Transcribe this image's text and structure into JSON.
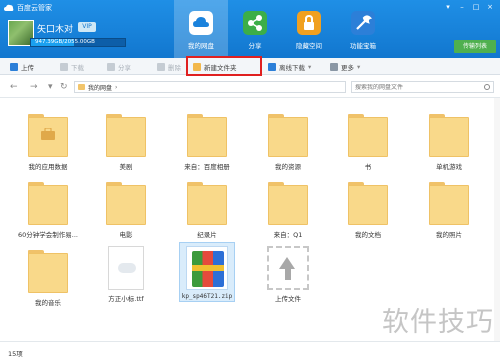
{
  "app": {
    "title": "百度云管家"
  },
  "user": {
    "name": "矢口木对",
    "vip_label": "VIP",
    "quota_text": "947.39GB/2055.00GB",
    "quota_fraction": 0.46
  },
  "nav_tabs": [
    {
      "label": "我的网盘",
      "icon": "cloud-drive-icon",
      "color": "#ffffff"
    },
    {
      "label": "分享",
      "icon": "share-icon",
      "color": "#3cae48"
    },
    {
      "label": "隐藏空间",
      "icon": "lock-icon",
      "color": "#f0a020"
    },
    {
      "label": "功能宝箱",
      "icon": "tools-icon",
      "color": "#2c7fd8"
    }
  ],
  "transfer_button": "传输列表",
  "toolbar": {
    "upload": "上传",
    "download": "下载",
    "share": "分享",
    "delete": "删除",
    "new_folder": "新建文件夹",
    "offline_download": "离线下载",
    "more": "更多"
  },
  "address": {
    "path": "我的网盘",
    "search_placeholder": "搜索我的网盘文件"
  },
  "files": [
    {
      "name": "我的应用数据",
      "type": "folder-app"
    },
    {
      "name": "美剧",
      "type": "folder"
    },
    {
      "name": "来自：百度相册",
      "type": "folder"
    },
    {
      "name": "我的资源",
      "type": "folder"
    },
    {
      "name": "书",
      "type": "folder"
    },
    {
      "name": "单机游戏",
      "type": "folder"
    },
    {
      "name": "60分钟学会制作易...",
      "type": "folder"
    },
    {
      "name": "电影",
      "type": "folder"
    },
    {
      "name": "纪录片",
      "type": "folder"
    },
    {
      "name": "来自：Q1",
      "type": "folder"
    },
    {
      "name": "我的文档",
      "type": "folder"
    },
    {
      "name": "我的照片",
      "type": "folder"
    },
    {
      "name": "我的音乐",
      "type": "folder"
    },
    {
      "name": "方正小标.ttf",
      "type": "doc"
    },
    {
      "name": "kp_sp46T21.zip",
      "type": "zip"
    },
    {
      "name": "上传文件",
      "type": "upload"
    }
  ],
  "status": {
    "count": "15项"
  },
  "watermark": "软件技巧",
  "colors": {
    "header": "#1a82dc",
    "highlight": "#e02020",
    "folder": "#f9d98a"
  }
}
